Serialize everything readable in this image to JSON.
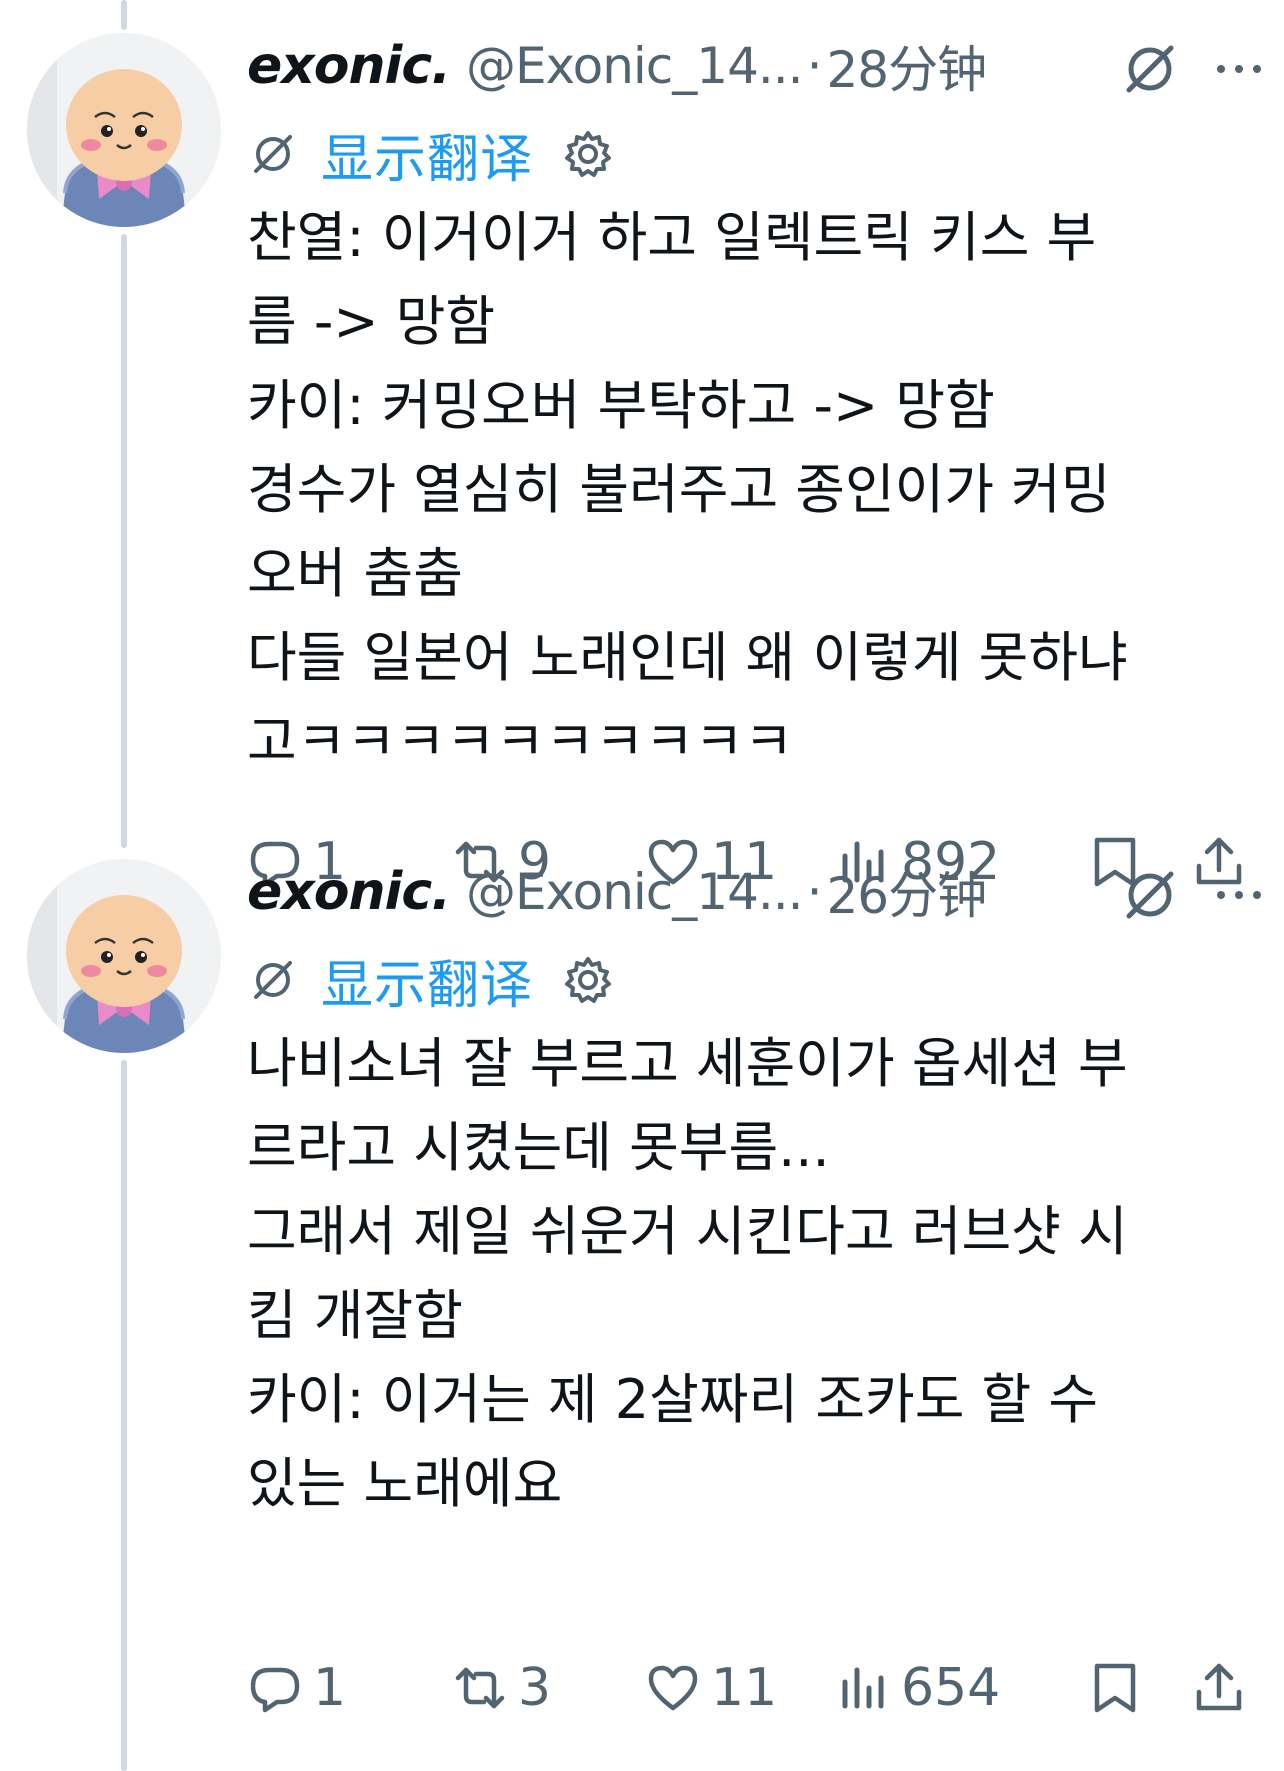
{
  "tweets": [
    {
      "display_name": "exonic.",
      "handle": "@Exonic_14...",
      "separator": "·",
      "time": "28分钟",
      "translate_label": "显示翻译",
      "body_lines": [
        "찬열: 이거이거 하고 일렉트릭 키스 부",
        "름 -> 망함",
        "카이: 커밍오버 부탁하고 -> 망함",
        "경수가 열심히 불러주고 종인이가 커밍",
        "오버 춤춤",
        "다들 일본어 노래인데 왜 이렇게 못하냐",
        "고ㅋㅋㅋㅋㅋㅋㅋㅋㅋㅋ"
      ],
      "replies": "1",
      "reposts": "9",
      "likes": "11",
      "views": "892"
    },
    {
      "display_name": "exonic.",
      "handle": "@Exonic_14...",
      "separator": "·",
      "time": "26分钟",
      "translate_label": "显示翻译",
      "body_lines": [
        "나비소녀 잘 부르고 세훈이가 옵세션 부",
        "르라고 시켰는데 못부름...",
        "그래서 제일 쉬운거 시킨다고 러브샷 시",
        "킴 개잘함",
        "카이: 이거는 제 2살짜리 조카도 할 수",
        "있는 노래에요"
      ],
      "replies": "1",
      "reposts": "3",
      "likes": "11",
      "views": "654"
    }
  ],
  "icons": {
    "grok": "grok-icon",
    "more": "more-icon",
    "settings": "settings-icon",
    "reply": "reply-icon",
    "repost": "repost-icon",
    "like": "like-icon",
    "views": "views-icon",
    "bookmark": "bookmark-icon",
    "share": "share-icon"
  },
  "colors": {
    "text": "#0f1419",
    "secondary": "#536471",
    "link": "#1d9bf0",
    "thread_line": "#cfd9de"
  }
}
